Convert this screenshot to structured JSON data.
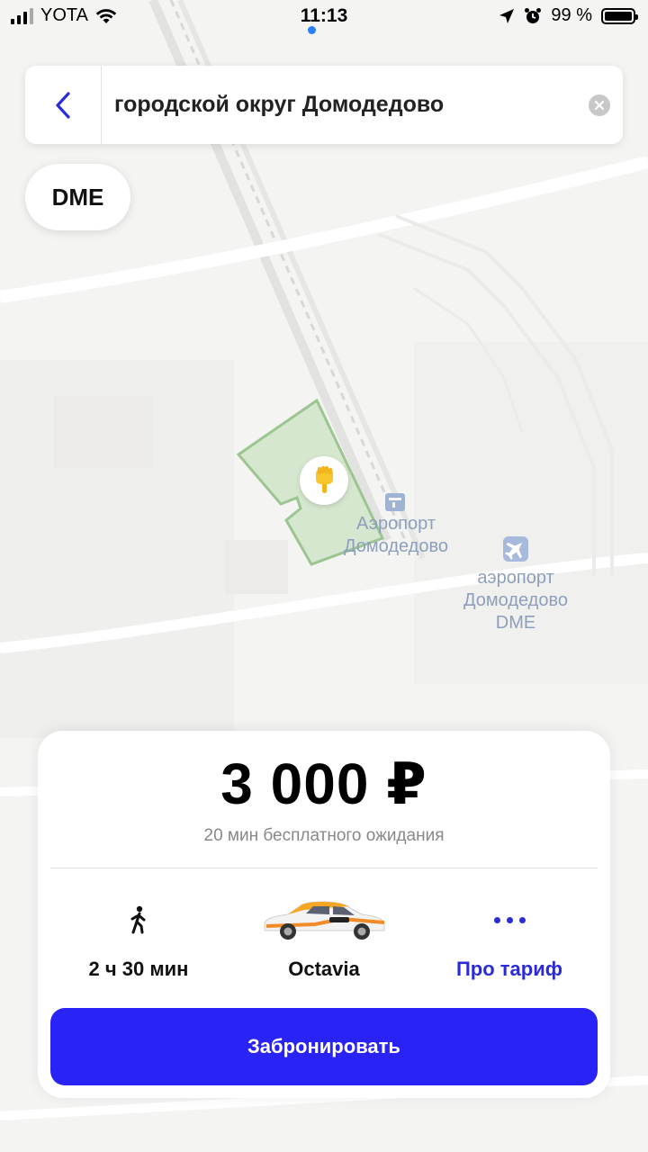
{
  "status_bar": {
    "carrier": "YOTA",
    "time": "11:13",
    "battery_percent": "99 %",
    "battery_level": 0.99
  },
  "search": {
    "value": "городской округ Домодедово",
    "back_icon": "chevron-left-icon",
    "clear_icon": "clear-icon"
  },
  "map": {
    "chip_label": "DME",
    "label_1": "Аэропорт\nДомодедово",
    "label_2": "аэропорт\nДомодедово\nDME",
    "zone_color": "#d6e7cf",
    "pin_icon": "pointing-hand-icon"
  },
  "card": {
    "price": "3 000 ₽",
    "wait_text": "20 мин бесплатного ожидания",
    "walk_time": "2 ч 30 мин",
    "car_model": "Octavia",
    "tariff_label": "Про тариф",
    "book_button": "Забронировать",
    "accent_color": "#2a23f5"
  }
}
